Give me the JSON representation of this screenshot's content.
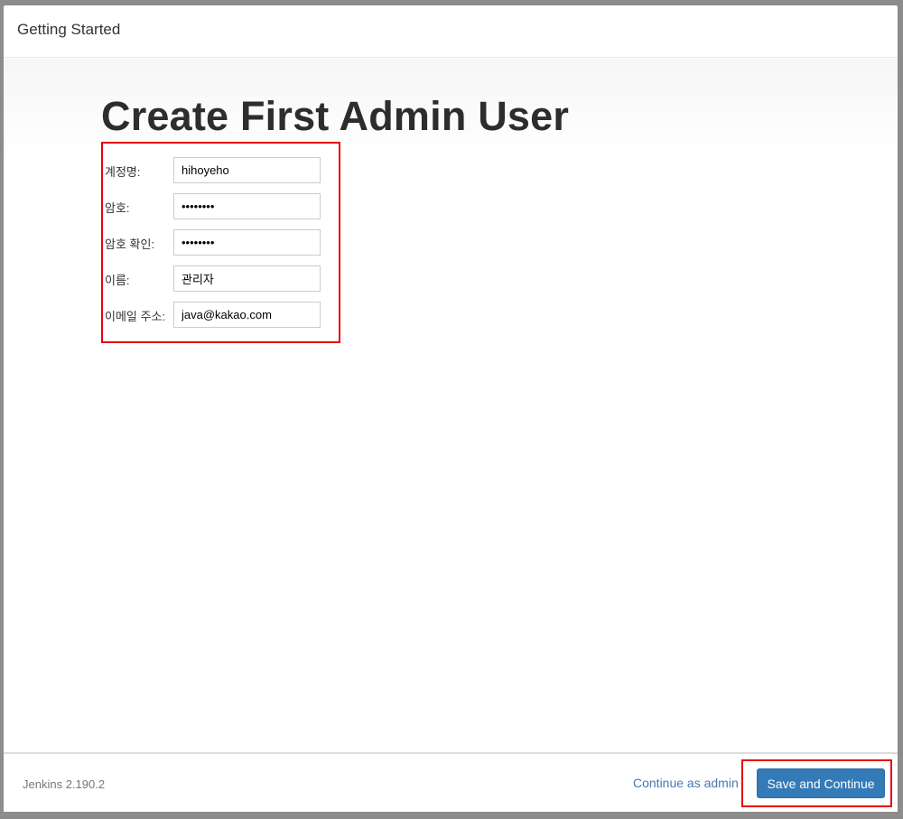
{
  "header": {
    "title": "Getting Started"
  },
  "main": {
    "heading": "Create First Admin User",
    "fields": [
      {
        "label": "계정명:",
        "value": "hihoyeho",
        "type": "text"
      },
      {
        "label": "암호:",
        "value": "••••••••",
        "type": "password"
      },
      {
        "label": "암호 확인:",
        "value": "••••••••",
        "type": "password"
      },
      {
        "label": "이름:",
        "value": "관리자",
        "type": "text"
      },
      {
        "label": "이메일 주소:",
        "value": "java@kakao.com",
        "type": "text"
      }
    ]
  },
  "footer": {
    "version": "Jenkins 2.190.2",
    "continue_label": "Continue as admin",
    "save_label": "Save and Continue"
  },
  "colors": {
    "primary_button": "#337ab7",
    "link": "#4a78b0",
    "highlight": "#e60012"
  }
}
